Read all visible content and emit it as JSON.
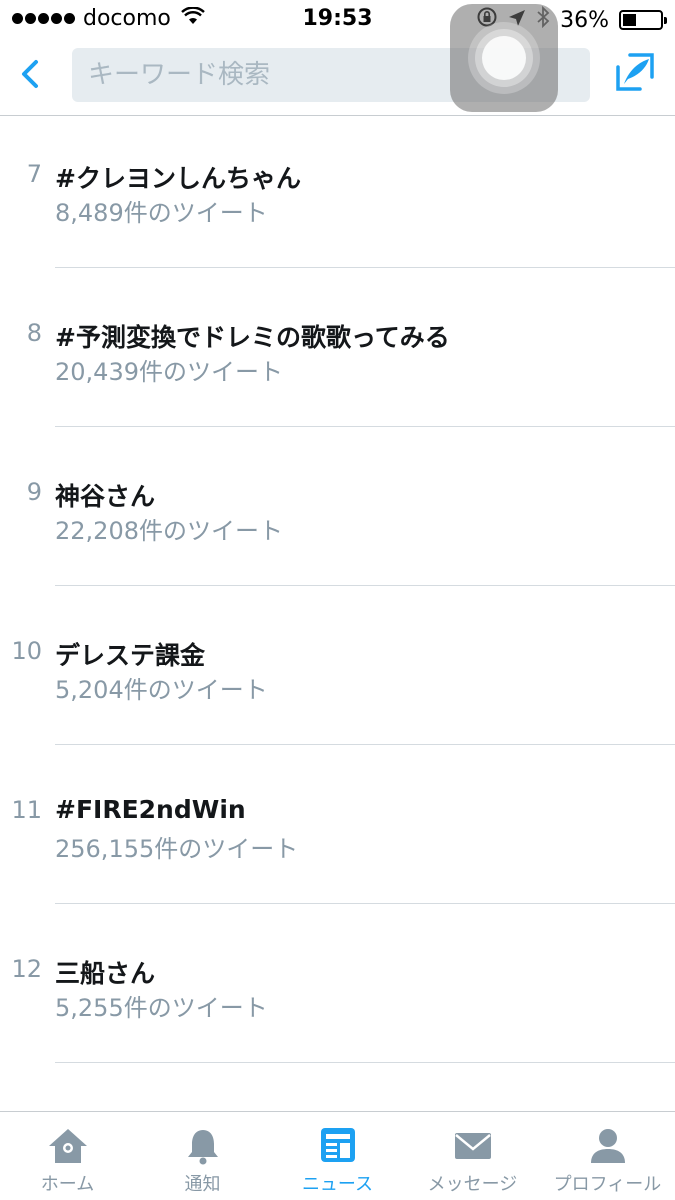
{
  "status_bar": {
    "carrier": "docomo",
    "time": "19:53",
    "battery": "36%",
    "battery_level": 0.36
  },
  "header": {
    "search_placeholder": "キーワード検索"
  },
  "trends": [
    {
      "rank": "7",
      "name": "#クレヨンしんちゃん",
      "count": "8,489件のツイート"
    },
    {
      "rank": "8",
      "name": "#予測変換でドレミの歌歌ってみる",
      "count": "20,439件のツイート"
    },
    {
      "rank": "9",
      "name": "神谷さん",
      "count": "22,208件のツイート"
    },
    {
      "rank": "10",
      "name": "デレステ課金",
      "count": "5,204件のツイート"
    },
    {
      "rank": "11",
      "name": "#FIRE2ndWin",
      "count": "256,155件のツイート"
    },
    {
      "rank": "12",
      "name": "三船さん",
      "count": "5,255件のツイート"
    }
  ],
  "tabs": [
    {
      "label": "ホーム",
      "icon": "home-icon",
      "active": false
    },
    {
      "label": "通知",
      "icon": "bell-icon",
      "active": false
    },
    {
      "label": "ニュース",
      "icon": "news-icon",
      "active": true
    },
    {
      "label": "メッセージ",
      "icon": "envelope-icon",
      "active": false
    },
    {
      "label": "プロフィール",
      "icon": "person-icon",
      "active": false
    }
  ],
  "colors": {
    "accent": "#1da1f2",
    "muted": "#8899a6",
    "text": "#14171a",
    "search_bg": "#e6ecf0"
  }
}
